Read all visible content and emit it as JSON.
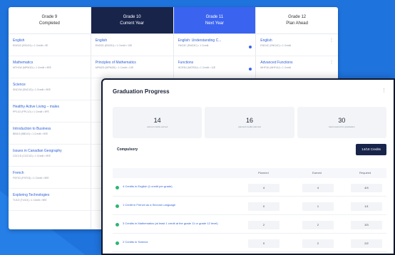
{
  "planner": {
    "columns": [
      {
        "title": "Grade 9",
        "subtitle": "Completed",
        "style": "plain",
        "courses": [
          {
            "name": "English",
            "meta": "ENG1D (EN1D1) • 1 Credit • 9E"
          },
          {
            "name": "Mathematics",
            "meta": "MTH1W (MPM1D) • 1 Credit • 9EE"
          },
          {
            "name": "Science",
            "meta": "SNC1W (SNC1D) • 1 Credit • 9EE"
          },
          {
            "name": "Healthy Active Living – males",
            "meta": "PPL1O (PPL1O) • 1 Credit • 9FE"
          },
          {
            "name": "Introduction to Business",
            "meta": "BBI1O (BBI1O) • 1 Credit • 9EE"
          },
          {
            "name": "Issues in Canadian Geography",
            "meta": "CGC1D (CGC1D) • 1 Credit • 9EE"
          },
          {
            "name": "French",
            "meta": "FSF1D (FSF1D) • 1 Credit • 9EE"
          },
          {
            "name": "Exploring Technologies",
            "meta": "TIJ1O (TIJ1O) • 1 Credit • 9EE"
          }
        ]
      },
      {
        "title": "Grade 10",
        "subtitle": "Current Year",
        "style": "dark",
        "courses": [
          {
            "name": "English",
            "meta": "ENG2D (EN2D1) • 1 Credit • 10E"
          },
          {
            "name": "Principles of Mathematics",
            "meta": "MPM2D (MPM2D) • 1 Credit • 10E"
          },
          {
            "name": "",
            "meta": ""
          },
          {
            "name": "",
            "meta": ""
          },
          {
            "name": "",
            "meta": ""
          },
          {
            "name": "",
            "meta": ""
          },
          {
            "name": "",
            "meta": ""
          },
          {
            "name": "",
            "meta": ""
          }
        ]
      },
      {
        "title": "Grade 11",
        "subtitle": "Next Year",
        "style": "blue",
        "courses": [
          {
            "name": "English: Understanding C...",
            "meta": "ENG3C (ENG3C) • 1 Credit"
          },
          {
            "name": "Functions",
            "meta": "MCR3U (MCR3U) • 1 Credit • 11E"
          },
          {
            "name": "",
            "meta": ""
          },
          {
            "name": "",
            "meta": ""
          },
          {
            "name": "",
            "meta": ""
          },
          {
            "name": "",
            "meta": ""
          },
          {
            "name": "",
            "meta": ""
          },
          {
            "name": "",
            "meta": ""
          }
        ]
      },
      {
        "title": "Grade 12",
        "subtitle": "Plan Ahead",
        "style": "plain",
        "courses": [
          {
            "name": "English",
            "meta": "ENG4C (ENG4C) • 1 Credit"
          },
          {
            "name": "Advanced Functions",
            "meta": "MHF4U (MHF4U) • 1 Credit"
          },
          {
            "name": "",
            "meta": ""
          },
          {
            "name": "",
            "meta": ""
          },
          {
            "name": "",
            "meta": ""
          },
          {
            "name": "",
            "meta": ""
          },
          {
            "name": "",
            "meta": ""
          },
          {
            "name": "",
            "meta": ""
          }
        ]
      }
    ]
  },
  "progress": {
    "title": "Graduation Progress",
    "menu_icon": "kebab-icon",
    "stats": [
      {
        "value": "14",
        "label": "earned credits earned"
      },
      {
        "value": "16",
        "label": "planned credits planned"
      },
      {
        "value": "30",
        "label": "total required for graduation"
      }
    ],
    "compulsory_label": "Compulsory",
    "credits_button": "14/18 Credits",
    "columns": [
      "Planned",
      "Earned",
      "Required"
    ],
    "requirements": [
      {
        "text": "4 Credits in English (1 credit per grade)",
        "planned": "4",
        "earned": "4",
        "required": "4/4"
      },
      {
        "text": "1 Credit in French as a Second Language",
        "planned": "0",
        "earned": "1",
        "required": "1/1"
      },
      {
        "text": "3 Credits in Mathematics (at least 1 credit at the grade 11 or grade 12 level)",
        "planned": "2",
        "earned": "2",
        "required": "3/3"
      },
      {
        "text": "2 Credits in Science",
        "planned": "0",
        "earned": "2",
        "required": "2/2"
      }
    ]
  },
  "colors": {
    "background": "#1f73dd",
    "dark_header": "#18244a",
    "blue_header": "#3a63f0",
    "check": "#2bb673"
  }
}
